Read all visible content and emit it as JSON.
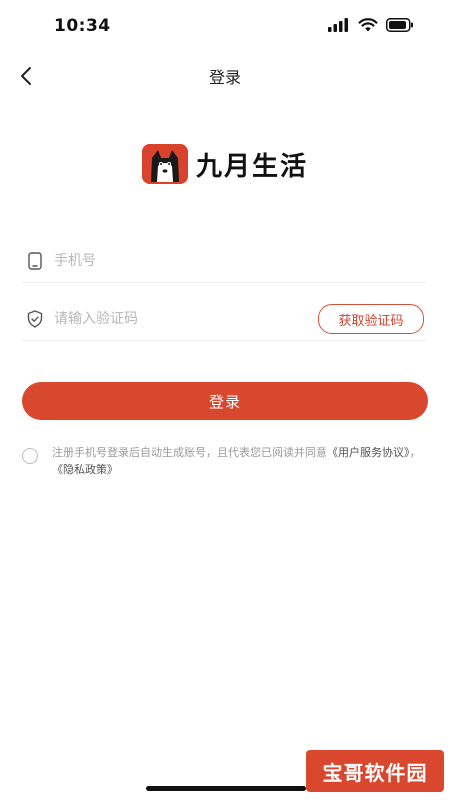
{
  "status_bar": {
    "time": "10:34"
  },
  "nav": {
    "title": "登录"
  },
  "brand": {
    "name": "九月生活"
  },
  "form": {
    "phone_placeholder": "手机号",
    "code_placeholder": "请输入验证码",
    "get_code_label": "获取验证码"
  },
  "login_button_label": "登录",
  "agreement": {
    "prefix": "注册手机号登录后自动生成账号，且代表您已阅读并同意",
    "user_agreement": "《用户服务协议》",
    "separator": "，",
    "privacy_policy": "《隐私政策》"
  },
  "watermark": {
    "text": "宝哥软件园"
  },
  "colors": {
    "accent": "#d9472f",
    "placeholder": "#b8b8b8",
    "divider": "#ececec"
  },
  "icons": {
    "back": "chevron-left-icon",
    "phone": "phone-icon",
    "shield": "shield-check-icon",
    "signal": "signal-icon",
    "wifi": "wifi-icon",
    "battery": "battery-icon"
  }
}
